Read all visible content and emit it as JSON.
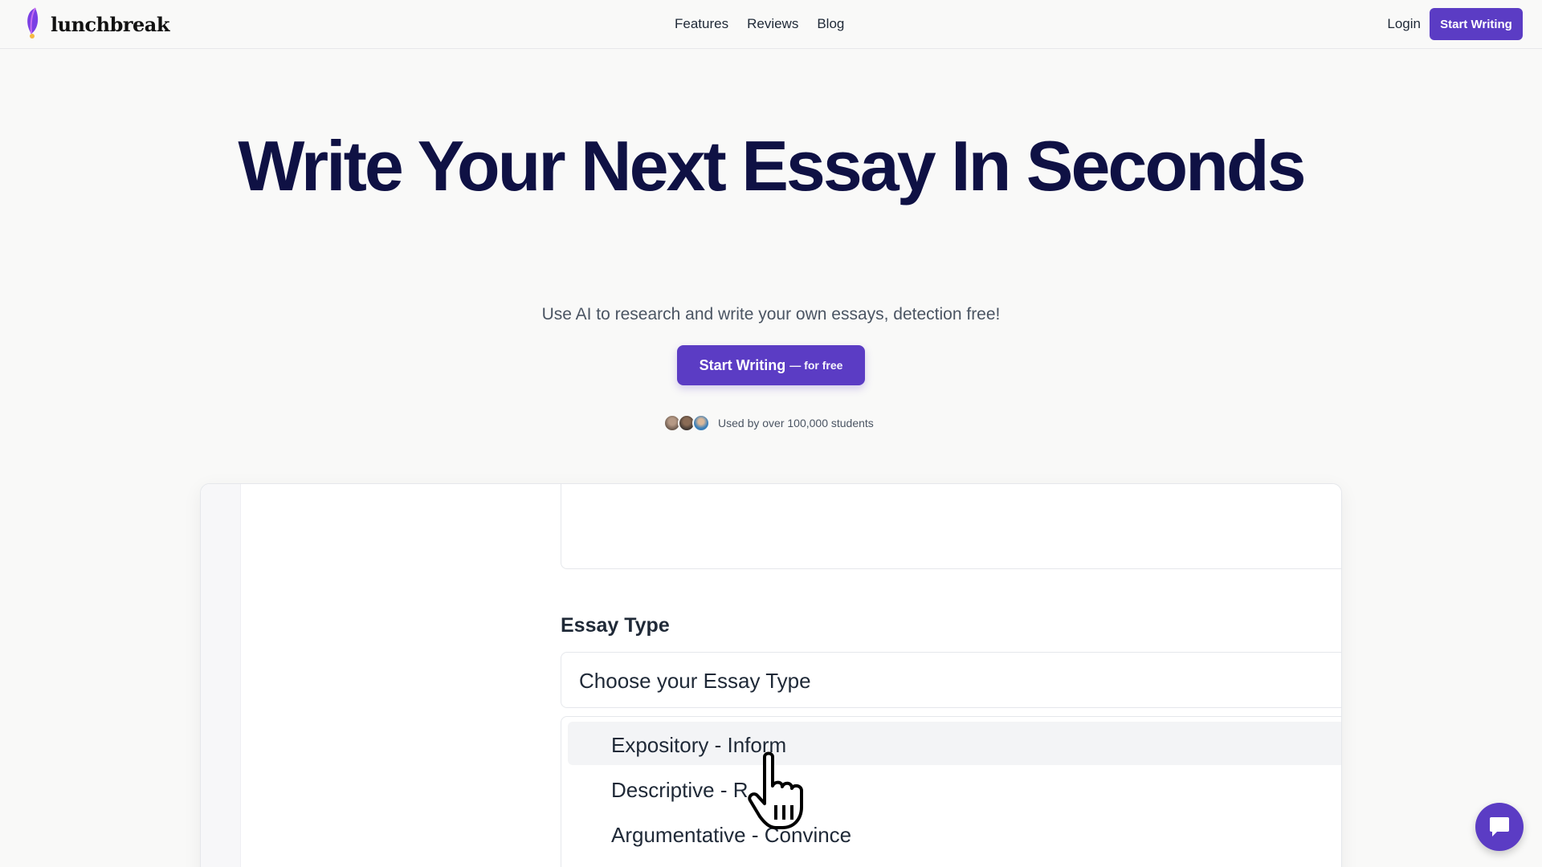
{
  "brand": {
    "name": "lunchbreak",
    "accent": "#5b3cc4",
    "title_color": "#0f1144"
  },
  "nav": {
    "items": [
      {
        "label": "Features"
      },
      {
        "label": "Reviews"
      },
      {
        "label": "Blog"
      }
    ]
  },
  "header": {
    "login_label": "Login",
    "start_label": "Start Writing"
  },
  "hero": {
    "title": "Write Your Next Essay In Seconds",
    "subtitle": "Use AI to research and write your own essays, detection free!",
    "cta_main": "Start Writing",
    "cta_sub": "— for free",
    "social_proof": "Used by over 100,000 students"
  },
  "demo": {
    "essay_type_label": "Essay Type",
    "select_placeholder": "Choose your Essay Type",
    "options": [
      {
        "label": "Expository - Inform",
        "selected": true
      },
      {
        "label": "Descriptive - R"
      },
      {
        "label": "Argumentative - Convince"
      }
    ]
  },
  "icons": {
    "logo": "feather-logo-icon",
    "cursor": "hand-pointer-icon",
    "chat": "chat-bubble-icon"
  }
}
